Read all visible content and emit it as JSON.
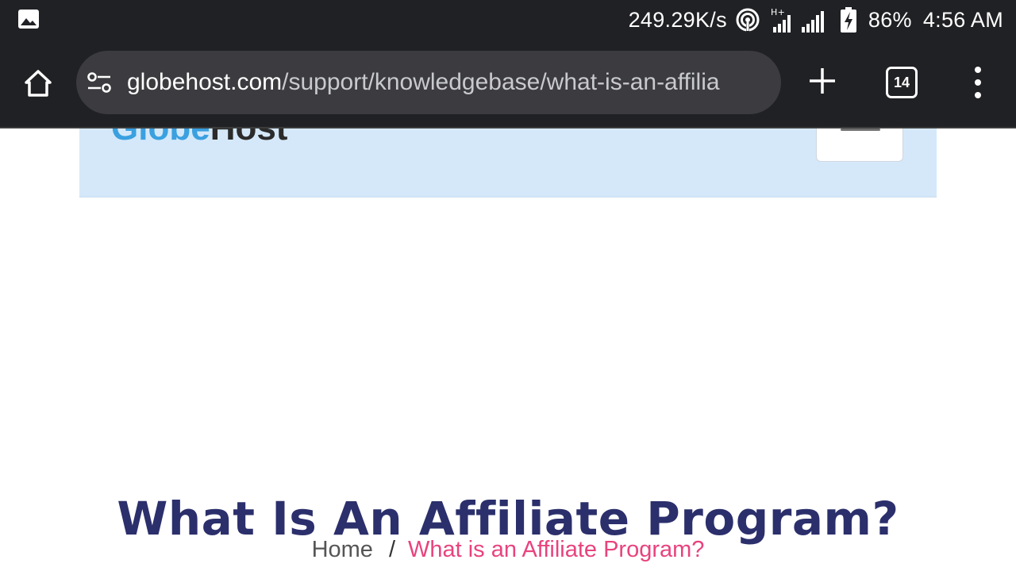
{
  "status_bar": {
    "network_speed": "249.29K/s",
    "network_type": "H+",
    "battery_percent": "86%",
    "time": "4:56 AM",
    "icons": [
      "gallery-icon",
      "hotspot-icon",
      "signal-icon",
      "battery-charging-icon"
    ]
  },
  "browser": {
    "url_domain": "globehost.com",
    "url_path": "/support/knowledgebase/what-is-an-affilia",
    "tab_count": "14",
    "icons": [
      "home-icon",
      "site-settings-icon",
      "plus-icon",
      "tab-switcher-icon",
      "more-vert-icon"
    ]
  },
  "site": {
    "logo_part1": "Globe",
    "logo_part2": "Host",
    "logo_colors": {
      "part1": "#3aa0e0",
      "part2": "#2b2b2b"
    }
  },
  "article": {
    "title": "What Is An Affiliate Program?",
    "breadcrumb": {
      "home": "Home",
      "separator": "/",
      "current": "What is an Affiliate Program?"
    }
  },
  "colors": {
    "chrome_bg": "#202124",
    "omnibox_bg": "#3c3c40",
    "header_bg": "#d5e8f9",
    "title": "#2b2f6b",
    "breadcrumb_current": "#e8437e"
  }
}
